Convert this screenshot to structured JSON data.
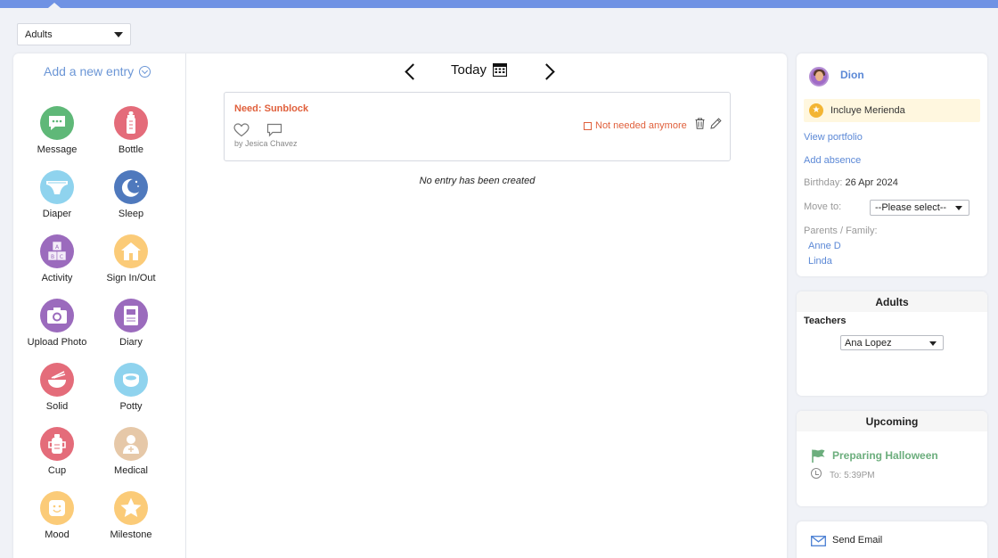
{
  "filter": {
    "selected": "Adults"
  },
  "left": {
    "add_entry": "Add a new entry",
    "tiles": [
      {
        "label": "Message",
        "color": "#5fb878",
        "icon": "message-icon"
      },
      {
        "label": "Bottle",
        "color": "#e46c7a",
        "icon": "bottle-icon"
      },
      {
        "label": "Diaper",
        "color": "#8fd3ee",
        "icon": "diaper-icon"
      },
      {
        "label": "Sleep",
        "color": "#4f79bd",
        "icon": "moon-icon"
      },
      {
        "label": "Activity",
        "color": "#9b6bbd",
        "icon": "blocks-icon"
      },
      {
        "label": "Sign In/Out",
        "color": "#fbcb78",
        "icon": "house-icon"
      },
      {
        "label": "Upload Photo",
        "color": "#9b6bbd",
        "icon": "camera-icon"
      },
      {
        "label": "Diary",
        "color": "#9b6bbd",
        "icon": "diary-icon"
      },
      {
        "label": "Solid",
        "color": "#e46c7a",
        "icon": "bowl-icon"
      },
      {
        "label": "Potty",
        "color": "#8fd3ee",
        "icon": "potty-icon"
      },
      {
        "label": "Cup",
        "color": "#e46c7a",
        "icon": "cup-icon"
      },
      {
        "label": "Medical",
        "color": "#e6c8a8",
        "icon": "medical-icon"
      },
      {
        "label": "Mood",
        "color": "#fbcb78",
        "icon": "smile-icon"
      },
      {
        "label": "Milestone",
        "color": "#fbcb78",
        "icon": "star-icon"
      }
    ]
  },
  "nav": {
    "today": "Today"
  },
  "entry": {
    "title": "Need: Sunblock",
    "author": "by Jesica Chavez",
    "not_needed": "Not needed anymore"
  },
  "empty_message": "No entry has been created",
  "profile": {
    "name": "Dion",
    "badge": "Incluye Merienda",
    "view_portfolio": "View portfolio",
    "add_absence": "Add absence",
    "birthday_label": "Birthday:",
    "birthday": "26 Apr 2024",
    "move_label": "Move to:",
    "move_value": "--Please select--",
    "parents_label": "Parents / Family:",
    "parents": [
      "Anne D",
      "Linda"
    ]
  },
  "adults_card": {
    "title": "Adults",
    "teachers_label": "Teachers",
    "teacher_selected": "Ana Lopez"
  },
  "upcoming": {
    "title": "Upcoming",
    "event": "Preparing Halloween",
    "time": "To: 5:39PM"
  },
  "actions": {
    "send_email": "Send Email"
  },
  "colors": {
    "accent": "#5b88d6",
    "alert": "#e0603c",
    "success": "#6cae7d",
    "topbar": "#6f92e4"
  }
}
